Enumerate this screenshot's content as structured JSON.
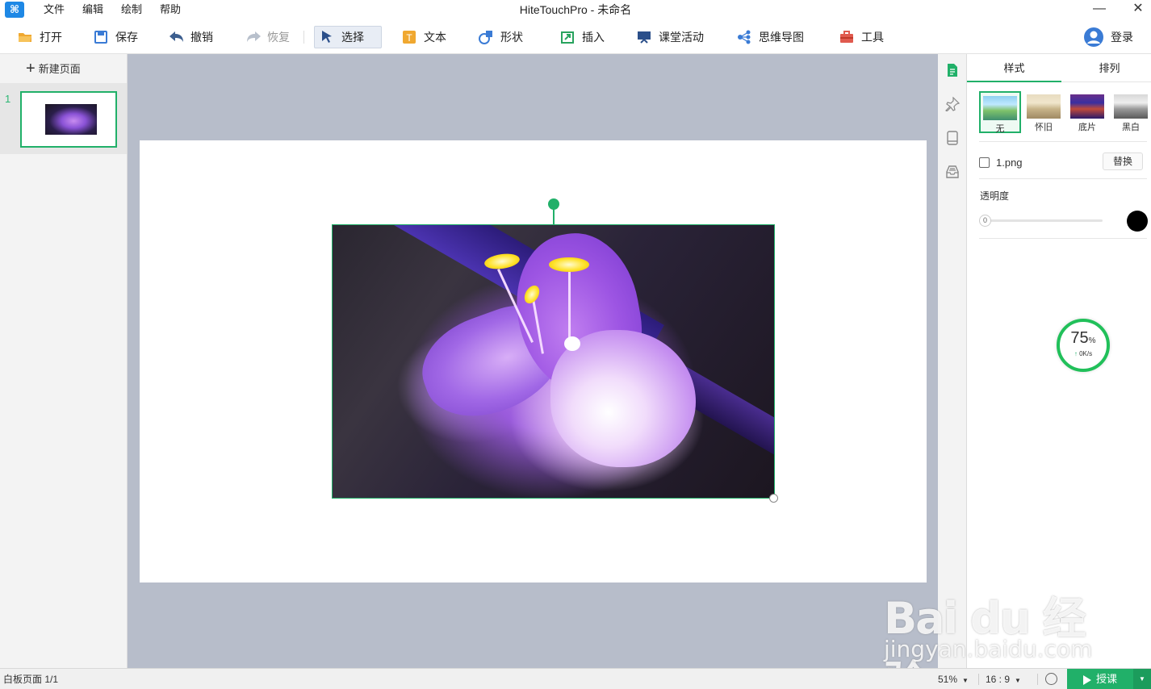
{
  "app": {
    "title": "HiteTouchPro - 未命名",
    "logo_icon": "hitetouch-logo-icon"
  },
  "menu": [
    "文件",
    "编辑",
    "绘制",
    "帮助"
  ],
  "window_controls": {
    "minimize": "—",
    "close": "✕"
  },
  "toolbar": {
    "open": "打开",
    "save": "保存",
    "undo": "撤销",
    "redo": "恢复",
    "select": "选择",
    "text": "文本",
    "shape": "形状",
    "insert": "插入",
    "activity": "课堂活动",
    "mindmap": "思维导图",
    "tools": "工具",
    "login": "登录"
  },
  "left_panel": {
    "new_page": "新建页面",
    "pages": [
      {
        "number": "1"
      }
    ]
  },
  "right_panel": {
    "tabs": [
      "样式",
      "排列"
    ],
    "filters": [
      "无",
      "怀旧",
      "底片",
      "黑白"
    ],
    "file_name": "1.png",
    "replace": "替换",
    "opacity_label": "透明度",
    "opacity_value": "0",
    "color": "#000000"
  },
  "speed_widget": {
    "percent": "75",
    "percent_unit": "%",
    "rate": "0K/s"
  },
  "status_bar": {
    "page_info": "白板页面 1/1",
    "zoom": "51%",
    "ratio": "16 : 9",
    "start_class": "授课"
  },
  "watermark": {
    "main": "Bai du 经验",
    "sub": "jingyan.baidu.com"
  },
  "colors": {
    "accent": "#21b069",
    "canvas_bg": "#b7bdca"
  }
}
